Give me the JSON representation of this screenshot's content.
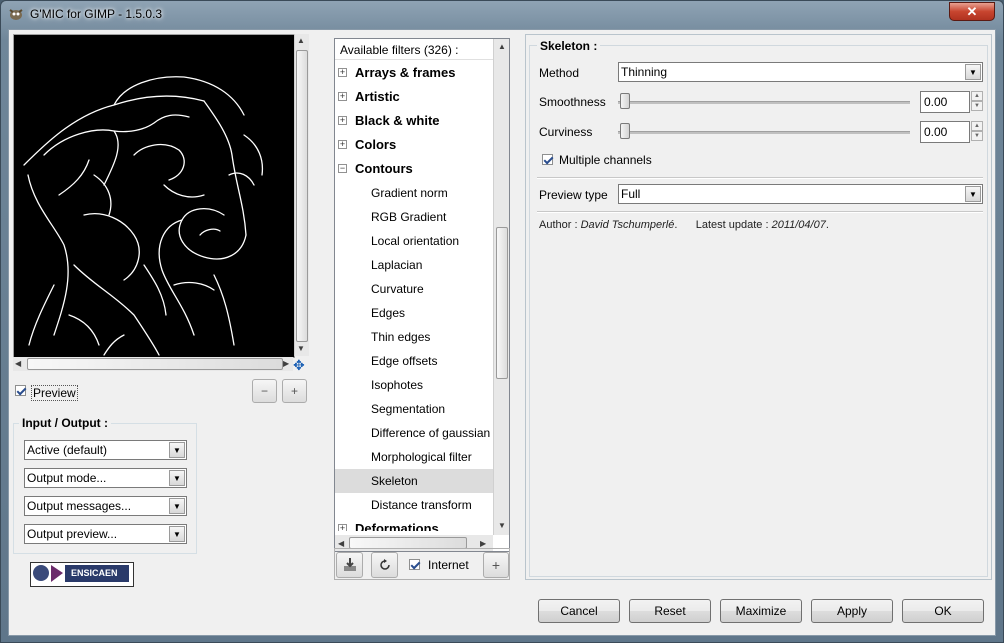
{
  "window": {
    "title": "G'MIC for GIMP - 1.5.0.3",
    "close_label": "✕"
  },
  "preview": {
    "checkbox_label": "Preview",
    "zoom_out_label": "−",
    "zoom_in_label": "+"
  },
  "io": {
    "title": "Input / Output :",
    "combos": [
      "Active (default)",
      "Output mode...",
      "Output messages...",
      "Output preview..."
    ]
  },
  "logo": {
    "text": "ENSICAEN"
  },
  "filters": {
    "header": "Available filters (326) :",
    "categories": [
      "Arrays & frames",
      "Artistic",
      "Black & white",
      "Colors",
      "Contours"
    ],
    "contours_items": [
      "Gradient norm",
      "RGB Gradient",
      "Local orientation",
      "Laplacian",
      "Curvature",
      "Edges",
      "Thin edges",
      "Edge offsets",
      "Isophotes",
      "Segmentation",
      "Difference of gaussian",
      "Morphological filter",
      "Skeleton",
      "Distance transform"
    ],
    "next_category": "Deformations",
    "selected": "Skeleton",
    "internet_label": "Internet",
    "add_label": "+"
  },
  "settings": {
    "title": "Skeleton :",
    "method_label": "Method",
    "method_value": "Thinning",
    "smoothness_label": "Smoothness",
    "smoothness_value": "0.00",
    "curviness_label": "Curviness",
    "curviness_value": "0.00",
    "multiple_channels_label": "Multiple channels",
    "preview_type_label": "Preview type",
    "preview_type_value": "Full",
    "author_prefix": "Author : ",
    "author_name": "David Tschumperlé",
    "update_prefix": "Latest update : ",
    "update_date": "2011/04/07"
  },
  "buttons": {
    "cancel": "Cancel",
    "reset": "Reset",
    "maximize": "Maximize",
    "apply": "Apply",
    "ok": "OK"
  }
}
